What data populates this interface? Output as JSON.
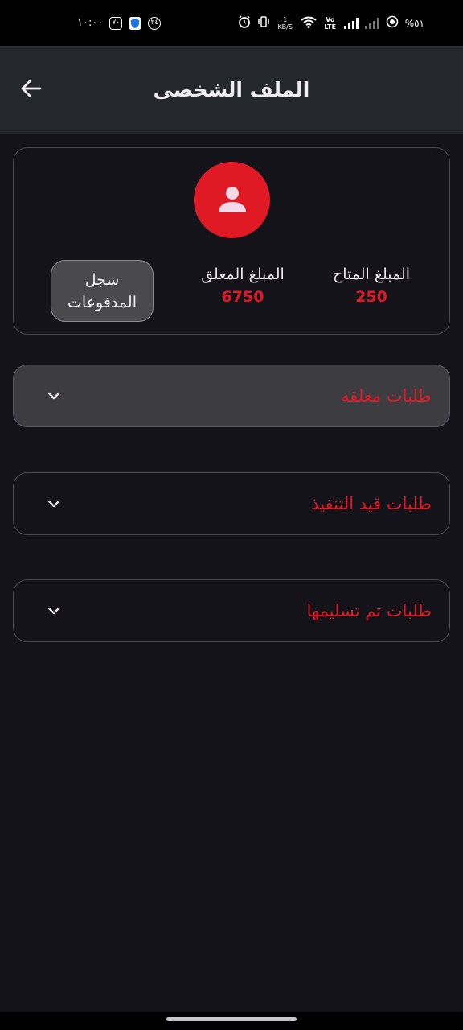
{
  "status_bar": {
    "time": "١٠:٠٠",
    "battery": "%٥١",
    "net_speed": "1 KB/S",
    "volte": "Vo LTE",
    "left_pills": [
      "٢٤",
      "٧٠"
    ]
  },
  "app_bar": {
    "title": "الملف الشخصى"
  },
  "profile": {
    "available_label": "المبلغ المتاح",
    "available_value": "250",
    "pending_label": "المبلغ المعلق",
    "pending_value": "6750",
    "payments_label_line1": "سجل",
    "payments_label_line2": "المدفوعات"
  },
  "sections": [
    {
      "label": "طلبات معلقه"
    },
    {
      "label": "طلبات قيد التنفيذ"
    },
    {
      "label": "طلبات تم تسليمها"
    }
  ],
  "colors": {
    "accent": "#e01a25",
    "background": "#15131a",
    "app_bar": "#24272c"
  },
  "icons": {
    "back": "arrow-left-icon",
    "avatar": "person-icon",
    "expand": "chevron-down-icon"
  }
}
